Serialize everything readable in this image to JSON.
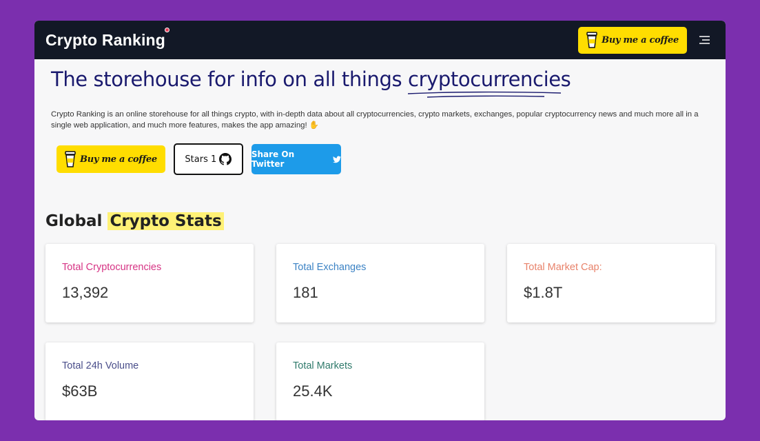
{
  "nav": {
    "brand": "Crypto Ranking",
    "bmc_label": "Buy me a coffee"
  },
  "hero": {
    "headline_prefix": "The storehouse for info on all things ",
    "headline_highlight": "cryptocurrencies",
    "description": "Crypto Ranking is an online storehouse for all things crypto, with in-depth data about all cryptocurrencies, crypto markets, exchanges, popular cryptocurrency news and much more all in a single web application, and much more features, makes the app amazing! ✋",
    "bmc_label": "Buy me a coffee",
    "stars_label": "Stars 1",
    "twitter_label": "Share On Twitter"
  },
  "stats": {
    "title_prefix": "Global ",
    "title_highlight": "Crypto Stats",
    "cards": [
      {
        "label": "Total Cryptocurrencies",
        "value": "13,392",
        "color": "#d63384"
      },
      {
        "label": "Total Exchanges",
        "value": "181",
        "color": "#3b82c4"
      },
      {
        "label": "Total Market Cap:",
        "value": "$1.8T",
        "color": "#e8826a"
      },
      {
        "label": "Total 24h Volume",
        "value": "$63B",
        "color": "#4a4e8a"
      },
      {
        "label": "Total Markets",
        "value": "25.4K",
        "color": "#2f7a6b"
      }
    ]
  },
  "colors": {
    "background": "#7b2fae",
    "navbar": "#121826",
    "coffee_yellow": "#ffdd00",
    "twitter_blue": "#1d9be9",
    "headline": "#1a1a6e"
  }
}
